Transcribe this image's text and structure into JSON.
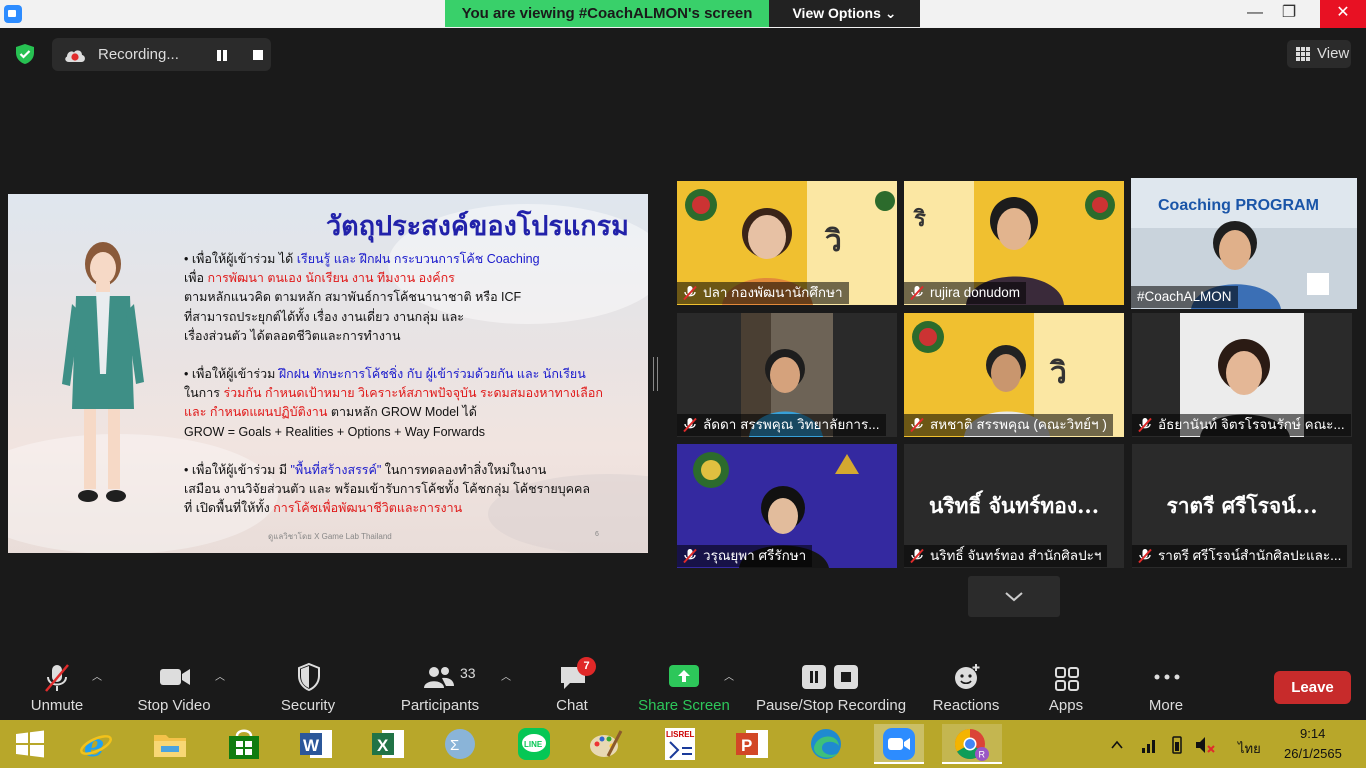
{
  "topbar": {
    "viewing": "You are viewing #CoachALMON's screen",
    "view_options": "View Options ⌄",
    "min": "—",
    "max": "❐",
    "close": "✕"
  },
  "recording": {
    "label": "Recording..."
  },
  "view_button": "View",
  "slide": {
    "title": "วัตถุประสงค์ของโปรแกรม",
    "p1": [
      [
        "• เพื่อให้ผู้เข้าร่วม ได้ ",
        "เรียนรู้ และ ฝึกฝน กระบวนการโค้ช Coaching",
        ""
      ],
      [
        "เพื่อ ",
        "การพัฒนา ตนเอง นักเรียน งาน ทีมงาน องค์กร",
        ""
      ],
      [
        "ตามหลักแนวคิด ตามหลัก สมาพันธ์การโค้ชนานาชาติ หรือ ICF",
        "",
        ""
      ],
      [
        "ที่สามารถประยุกต์ได้ทั้ง เรื่อง งานเดี่ยว งานกลุ่ม และ",
        "",
        ""
      ],
      [
        "เรื่องส่วนตัว ได้ตลอดชีวิตและการทำงาน",
        "",
        ""
      ]
    ],
    "p2": [
      [
        "• เพื่อให้ผู้เข้าร่วม ",
        "ฝึกฝน ทักษะการโค้ชชิ่ง กับ ผู้เข้าร่วมด้วยกัน และ นักเรียน",
        ""
      ],
      [
        "ในการ ",
        "ร่วมกัน กำหนดเป้าหมาย วิเคราะห์สภาพปัจจุบัน ระดมสมองหาทางเลือก",
        ""
      ],
      [
        "",
        "และ กำหนดแผนปฏิบัติงาน",
        " ตามหลัก GROW Model ได้"
      ],
      [
        "GROW = Goals + Realities + Options + Way Forwards",
        "",
        ""
      ]
    ],
    "p3": [
      [
        "• เพื่อให้ผู้เข้าร่วม มี ",
        "\"พื้นที่สร้างสรรค์\"",
        " ในการทดลองทำสิ่งใหม่ในงาน"
      ],
      [
        "เสมือน งานวิจัยส่วนตัว และ พร้อมเข้ารับการโค้ชทั้ง โค้ชกลุ่ม โค้ชรายบุคคล",
        "",
        ""
      ],
      [
        "ที่ เปิดพื้นที่ให้ทั้ง ",
        "การโค้ชเพื่อพัฒนาชีวิตและการงาน",
        ""
      ]
    ],
    "footer": "ดูแลวิชาโดย X Game Lab Thailand",
    "page_num": "6"
  },
  "participants": [
    {
      "name": "ปลา กองพัฒนานักศึกษา",
      "big": ""
    },
    {
      "name": "rujira donudom",
      "big": ""
    },
    {
      "name": "#CoachALMON",
      "big": ""
    },
    {
      "name": "ลัดดา สรรพคุณ วิทยาลัยการ...",
      "big": ""
    },
    {
      "name": "สหชาติ สรรพคุณ (คณะวิทย์ฯ )",
      "big": ""
    },
    {
      "name": "อัธยานันท์ จิตรโรจนรักษ์ คณะ...",
      "big": ""
    },
    {
      "name": "วรุณยุพา ศรีรักษา",
      "big": ""
    },
    {
      "name": "นริทธิ์ จันทร์ทอง สำนักศิลปะฯ",
      "big": "นริทธิ์ จันทร์ทอง..."
    },
    {
      "name": "ราตรี   ศรีโรจน์สำนักศิลปะและ...",
      "big": "ราตรี   ศรีโรจน์..."
    }
  ],
  "toolbar": {
    "unmute": "Unmute",
    "stop_video": "Stop Video",
    "security": "Security",
    "participants": "Participants",
    "participants_count": "33",
    "chat": "Chat",
    "chat_badge": "7",
    "share_screen": "Share Screen",
    "pause_stop": "Pause/Stop Recording",
    "reactions": "Reactions",
    "apps": "Apps",
    "more": "More",
    "leave": "Leave"
  },
  "taskbar": {
    "lang": "ไทย",
    "time": "9:14",
    "date": "26/1/2565",
    "apps": [
      "windows-start",
      "internet-explorer",
      "file-explorer",
      "microsoft-store",
      "word",
      "excel",
      "math-input",
      "line",
      "paint",
      "lisrel",
      "powerpoint",
      "edge",
      "zoom",
      "chrome"
    ]
  },
  "colors": {
    "banner_green": "#39d06a",
    "active_speaker": "#b8f04a",
    "leave_red": "#c72b2b",
    "taskbar": "#b8a72a",
    "slide_blue": "#1a1acc",
    "slide_red": "#e01919"
  }
}
